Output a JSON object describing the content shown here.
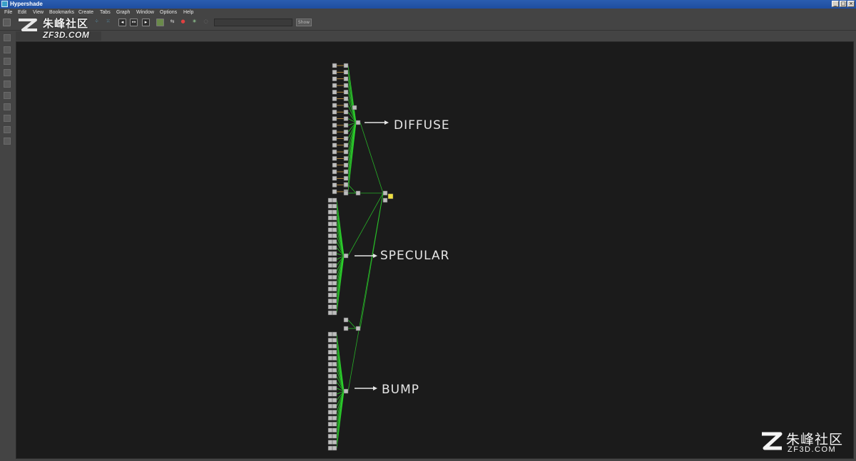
{
  "window": {
    "title": "Hypershade"
  },
  "window_controls": {
    "minimize": "_",
    "maximize": "□",
    "close": "×"
  },
  "menu": [
    "File",
    "Edit",
    "View",
    "Bookmarks",
    "Create",
    "Tabs",
    "Graph",
    "Window",
    "Options",
    "Help"
  ],
  "toolbar": {
    "show_label": "Show"
  },
  "watermark": {
    "cn": "朱峰社区",
    "en": "ZF3D.COM"
  },
  "graph": {
    "labels": {
      "diffuse": "DIFFUSE",
      "specular": "SPECULAR",
      "bump": "BUMP"
    },
    "group_node_counts": {
      "diffuse": 20,
      "specular": 20,
      "bump": 20
    },
    "colors": {
      "connection": "#2bd62b",
      "node": "#bdbdbd",
      "shader_node": "#f0e040",
      "label": "#e6e6e6"
    }
  }
}
